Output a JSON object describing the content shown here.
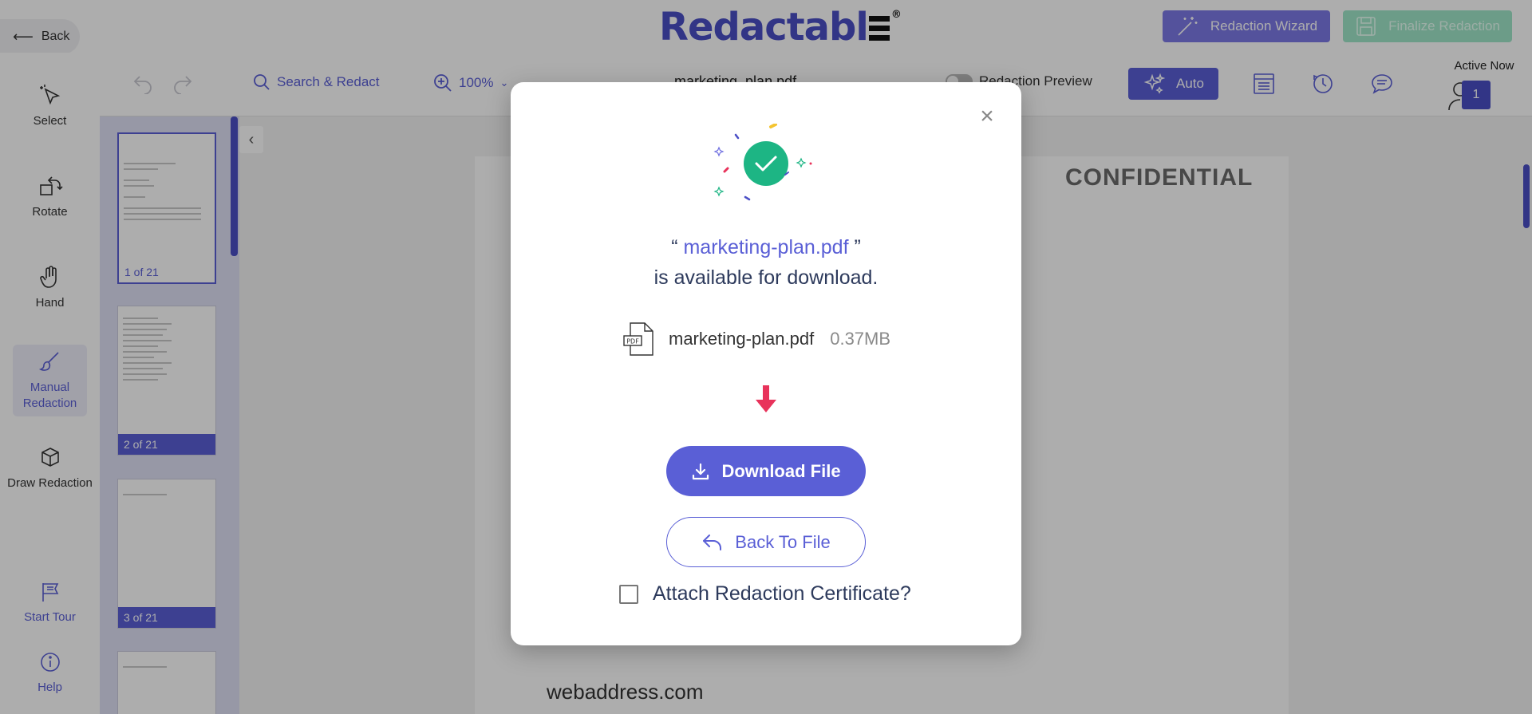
{
  "header": {
    "back_label": "Back",
    "logo_text": "Redactabl",
    "logo_mark": "®",
    "wizard_label": "Redaction Wizard",
    "finalize_label": "Finalize Redaction"
  },
  "toolbar": {
    "search_label": "Search & Redact",
    "zoom_value": "100%",
    "file_title": "marketing_plan.pdf",
    "preview_label": "Redaction Preview",
    "auto_label": "Auto",
    "active_now_label": "Active Now",
    "active_count": "1"
  },
  "sidebar": {
    "items": [
      {
        "label": "Select"
      },
      {
        "label": "Rotate"
      },
      {
        "label": "Hand"
      },
      {
        "label": "Manual Redaction"
      },
      {
        "label": "Draw Redaction"
      },
      {
        "label": "Start Tour"
      },
      {
        "label": "Help"
      }
    ]
  },
  "thumbnails": [
    {
      "label": "1 of 21"
    },
    {
      "label": "2 of 21"
    },
    {
      "label": "3 of 21"
    },
    {
      "label": ""
    }
  ],
  "document": {
    "heading": "CONFIDENTIAL",
    "footer_text": "webaddress.com"
  },
  "modal": {
    "open_quote": "“",
    "close_quote": "”",
    "file_name_highlight": "marketing-plan.pdf",
    "available_text": "is available for download.",
    "file_name": "marketing-plan.pdf",
    "file_size": "0.37MB",
    "download_label": "Download File",
    "back_to_file_label": "Back To File",
    "certificate_label": "Attach Redaction Certificate?",
    "certificate_checked": false
  },
  "colors": {
    "accent": "#5a5fd6",
    "logo": "#4b4fc6",
    "success": "#1db584",
    "arrow": "#e8335b",
    "finalize": "#9fe6c9"
  }
}
